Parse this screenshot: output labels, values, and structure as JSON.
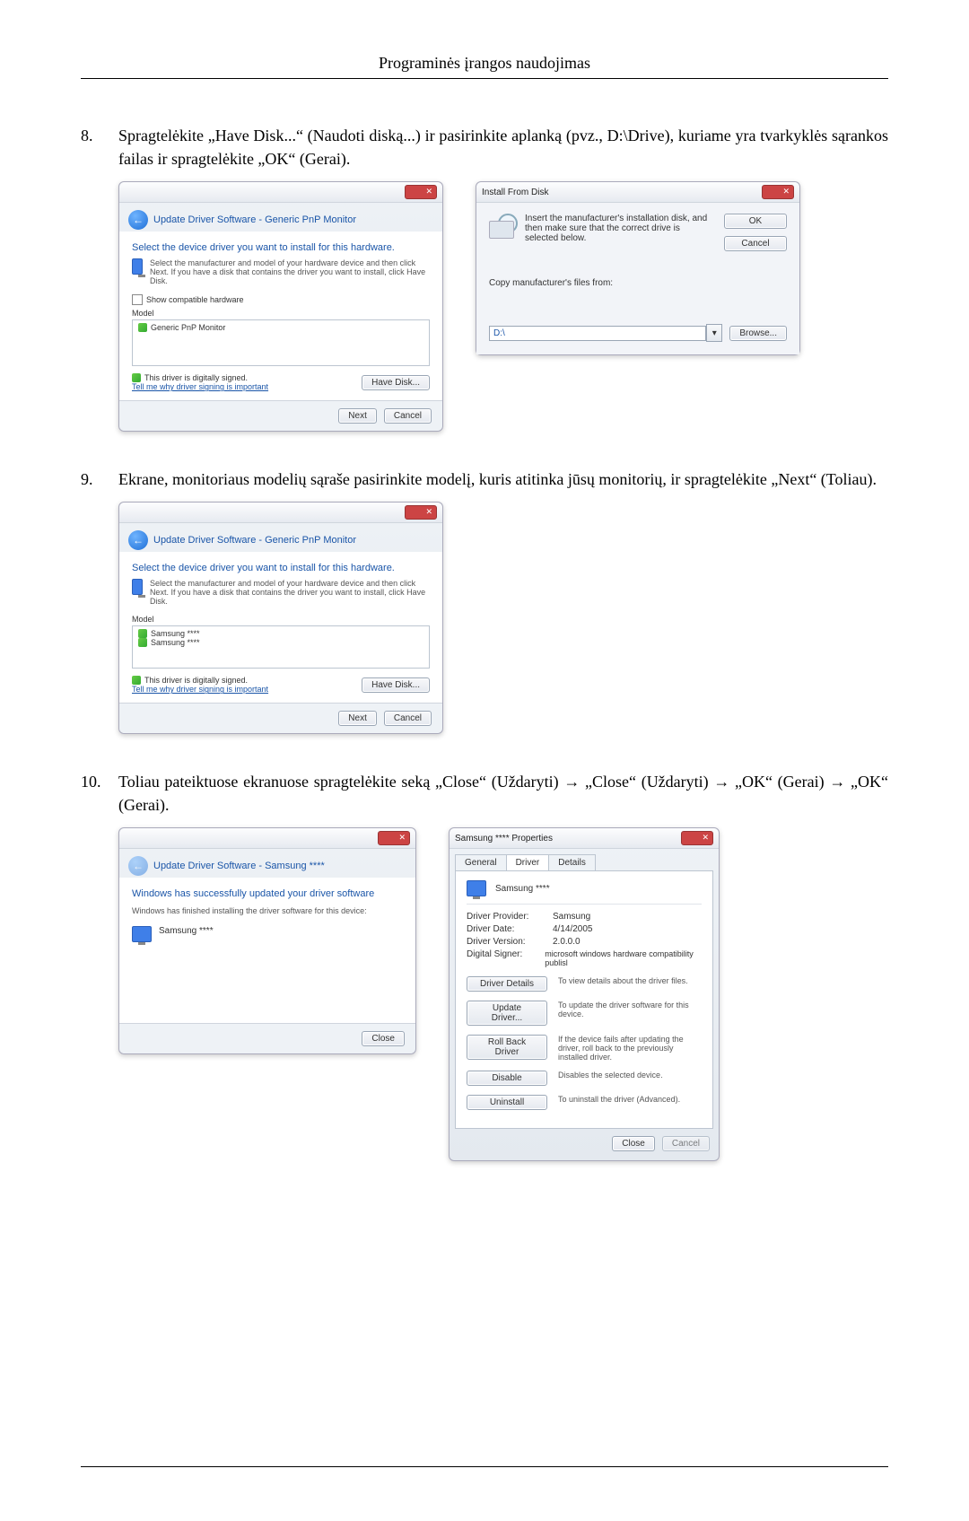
{
  "header": "Programinės įrangos naudojimas",
  "steps": {
    "s8": {
      "num": "8.",
      "text": "Spragtelėkite „Have Disk...“ (Naudoti diską...) ir pasirinkite aplanką (pvz., D:\\Drive), kuriame yra tvarkyklės sąrankos failas ir spragtelėkite „OK“ (Gerai)."
    },
    "s9": {
      "num": "9.",
      "text": "Ekrane, monitoriaus modelių sąraše pasirinkite modelį, kuris atitinka jūsų monitorių, ir spragtelėkite „Next“ (Toliau)."
    },
    "s10": {
      "num": "10.",
      "text": "Toliau pateiktuose ekranuose spragtelėkite seką „Close“ (Uždaryti)  →  „Close“ (Uždaryti)  → „OK“ (Gerai)  →  „OK“ (Gerai)."
    }
  },
  "dlgA": {
    "breadcrumb": "Update Driver Software - Generic PnP Monitor",
    "h": "Select the device driver you want to install for this hardware.",
    "info": "Select the manufacturer and model of your hardware device and then click Next. If you have a disk that contains the driver you want to install, click Have Disk.",
    "check": "Show compatible hardware",
    "model_label": "Model",
    "model_item": "Generic PnP Monitor",
    "signed": "This driver is digitally signed.",
    "signed_link": "Tell me why driver signing is important",
    "have_disk": "Have Disk...",
    "next": "Next",
    "cancel": "Cancel"
  },
  "dlgB": {
    "title": "Install From Disk",
    "msg": "Insert the manufacturer's installation disk, and then make sure that the correct drive is selected below.",
    "ok": "OK",
    "cancel": "Cancel",
    "copy_label": "Copy manufacturer's files from:",
    "path": "D:\\",
    "browse": "Browse..."
  },
  "dlgC": {
    "breadcrumb": "Update Driver Software - Generic PnP Monitor",
    "h": "Select the device driver you want to install for this hardware.",
    "info": "Select the manufacturer and model of your hardware device and then click Next. If you have a disk that contains the driver you want to install, click Have Disk.",
    "model_label": "Model",
    "item1": "Samsung ****",
    "item2": "Samsung ****",
    "signed": "This driver is digitally signed.",
    "signed_link": "Tell me why driver signing is important",
    "have_disk": "Have Disk...",
    "next": "Next",
    "cancel": "Cancel"
  },
  "dlgD": {
    "breadcrumb": "Update Driver Software - Samsung ****",
    "h": "Windows has successfully updated your driver software",
    "info2": "Windows has finished installing the driver software for this device:",
    "device": "Samsung ****",
    "close": "Close"
  },
  "dlgE": {
    "title": "Samsung **** Properties",
    "tabs": {
      "general": "General",
      "driver": "Driver",
      "details": "Details"
    },
    "device": "Samsung ****",
    "provider_k": "Driver Provider:",
    "provider_v": "Samsung",
    "date_k": "Driver Date:",
    "date_v": "4/14/2005",
    "version_k": "Driver Version:",
    "version_v": "2.0.0.0",
    "signer_k": "Digital Signer:",
    "signer_v": "microsoft windows hardware compatibility publisl",
    "btn_details": "Driver Details",
    "desc_details": "To view details about the driver files.",
    "btn_update": "Update Driver...",
    "desc_update": "To update the driver software for this device.",
    "btn_roll": "Roll Back Driver",
    "desc_roll": "If the device fails after updating the driver, roll back to the previously installed driver.",
    "btn_disable": "Disable",
    "desc_disable": "Disables the selected device.",
    "btn_uninstall": "Uninstall",
    "desc_uninstall": "To uninstall the driver (Advanced).",
    "close": "Close",
    "cancel": "Cancel"
  }
}
